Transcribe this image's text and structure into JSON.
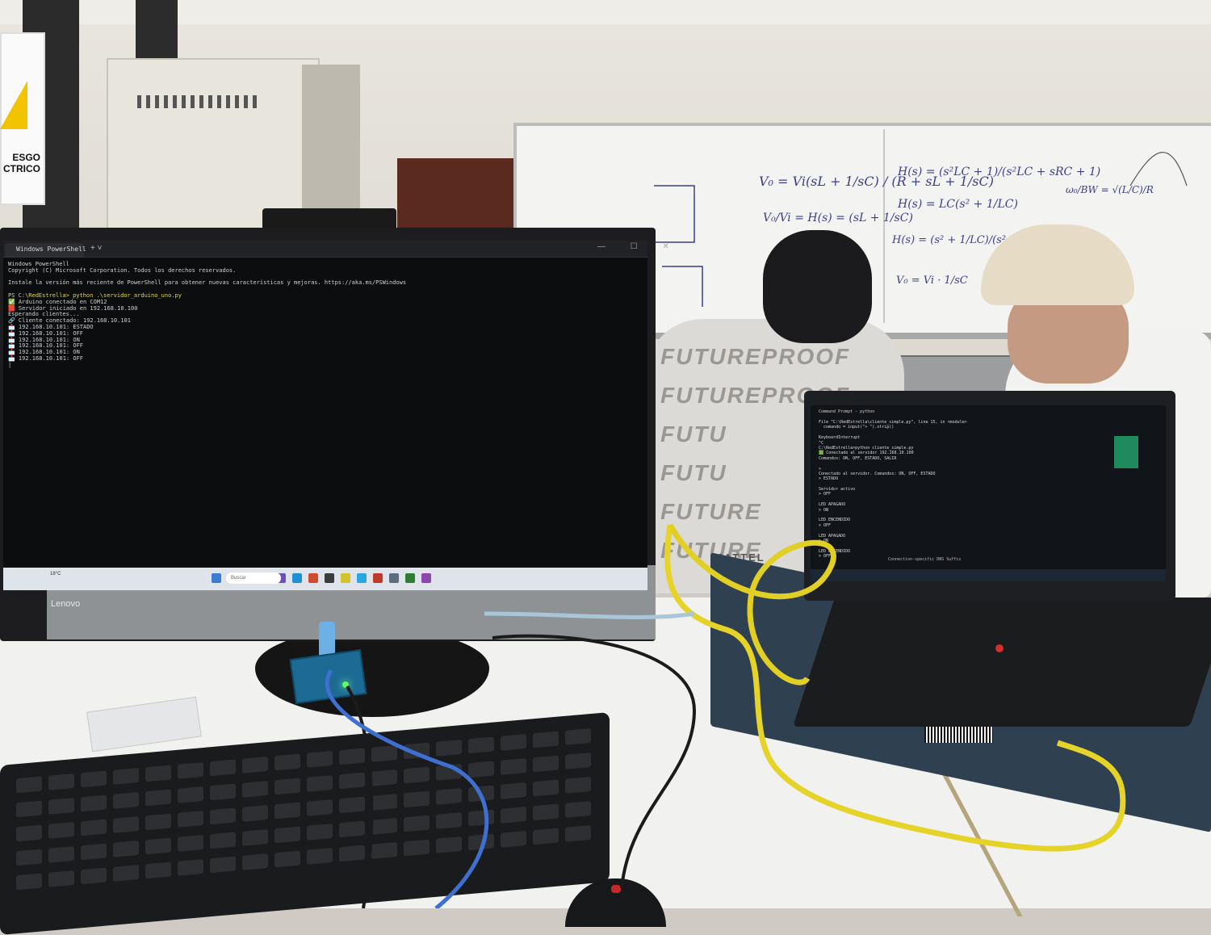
{
  "scene": {
    "description_labels": {
      "sign_text": "ESGO\nCTRICO",
      "monitor_brand": "Lenovo",
      "shirt_print": [
        "FUTUREPROOF",
        "FUTUREPROOF",
        "FUTU",
        "FUTU",
        "FUTURE",
        "FUTURE"
      ],
      "shirt_bottom": "MATTEL"
    }
  },
  "monitor": {
    "terminal_tab": "Windows PowerShell",
    "tab_plus": "+ ˅",
    "window_buttons": "— ☐ ✕",
    "lines": [
      {
        "text": "Windows PowerShell",
        "cls": ""
      },
      {
        "text": "Copyright (C) Microsoft Corporation. Todos los derechos reservados.",
        "cls": ""
      },
      {
        "text": "",
        "cls": ""
      },
      {
        "text": "Instale la versión más reciente de PowerShell para obtener nuevas características y mejoras. https://aka.ms/PSWindows",
        "cls": ""
      },
      {
        "text": "",
        "cls": ""
      },
      {
        "text": "PS C:\\RedEstrella> python .\\servidor_arduino_uno.py",
        "cls": "cmd"
      },
      {
        "text": "✅ Arduino conectado en COM12",
        "cls": ""
      },
      {
        "text": "🟥 Servidor iniciado en 192.168.10.100",
        "cls": ""
      },
      {
        "text": "Esperando clientes...",
        "cls": ""
      },
      {
        "text": "🔗 Cliente conectado: 192.168.10.101",
        "cls": ""
      },
      {
        "text": "📩 192.168.10.101: ESTADO",
        "cls": ""
      },
      {
        "text": "📩 192.168.10.101: OFF",
        "cls": ""
      },
      {
        "text": "📩 192.168.10.101: ON",
        "cls": ""
      },
      {
        "text": "📩 192.168.10.101: OFF",
        "cls": ""
      },
      {
        "text": "📩 192.168.10.101: ON",
        "cls": ""
      },
      {
        "text": "📩 192.168.10.101: OFF",
        "cls": ""
      },
      {
        "text": "|",
        "cls": ""
      }
    ],
    "taskbar_search": "Buscar",
    "taskbar_widget": "18°C"
  },
  "laptop": {
    "tab": "Command Prompt - python",
    "lines": [
      "File \"C:\\RedEstrella\\cliente_simple.py\", line 15, in <module>",
      "  comando = input(\"> \").strip()",
      "",
      "KeyboardInterrupt",
      "^C",
      "C:\\RedEstrella>python cliente_simple.py",
      "🟩 Conectado al servidor 192.168.10.100",
      "Comandos: ON, OFF, ESTADO, SALIR",
      "",
      "> ",
      "Conectado al servidor. Comandos: ON, OFF, ESTADO",
      "> ESTADO",
      "",
      "Servidor activo",
      "> OFF",
      "",
      "LED APAGADO",
      "> ON",
      "",
      "LED ENCENDIDO",
      "> OFF",
      "",
      "LED APAGADO",
      "> ON",
      "",
      "LED ENCENDIDO",
      "> OFF"
    ],
    "taskbar_note": "Connection-specific DNS Suffix"
  },
  "whiteboard": {
    "formulas": [
      "V₀ = Vi(sL + 1/sC) / (R + sL + 1/sC)",
      "V₀/Vi = H(s) = (sL + 1/sC)",
      "H(s) = (s²LC + 1)/(s²LC + sRC + 1)",
      "H(s) = LC(s² + 1/LC)",
      "H(s) = (s² + 1/LC)/(s² + sR/L + 1/LC)",
      "V₀ = Vi · 1/sC",
      "ω₀/BW = √(L/C)/R"
    ]
  }
}
